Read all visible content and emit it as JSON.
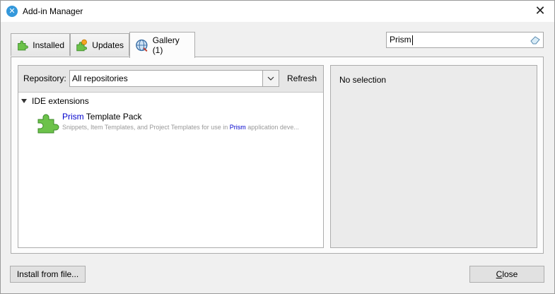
{
  "window": {
    "title": "Add-in Manager",
    "close_glyph": "✕",
    "app_icon": "xamarin-icon"
  },
  "tabs": [
    {
      "label": "Installed",
      "icon": "green-puzzle-icon",
      "active": false
    },
    {
      "label": "Updates",
      "icon": "puzzle-update-icon",
      "active": false
    },
    {
      "label": "Gallery (1)",
      "icon": "globe-icon",
      "active": true
    }
  ],
  "search": {
    "value": "Prism",
    "clear_icon": "eraser-icon"
  },
  "repository": {
    "label": "Repository:",
    "selected": "All repositories",
    "refresh_label": "Refresh"
  },
  "tree": {
    "group_label": "IDE extensions",
    "items": [
      {
        "title_highlight": "Prism",
        "title_rest": " Template Pack",
        "desc_before": "Snippets, Item Templates, and Project Templates for use in ",
        "desc_highlight": "Prism",
        "desc_after": " application deve...",
        "icon": "green-puzzle-icon"
      }
    ]
  },
  "details": {
    "empty_text": "No selection"
  },
  "buttons": {
    "install_label": "Install from file...",
    "close_label_u": "C",
    "close_label_rest": "lose"
  },
  "colors": {
    "highlight": "#0000cc",
    "desc_gray": "#999999",
    "puzzle_green": "#6cc24a"
  }
}
